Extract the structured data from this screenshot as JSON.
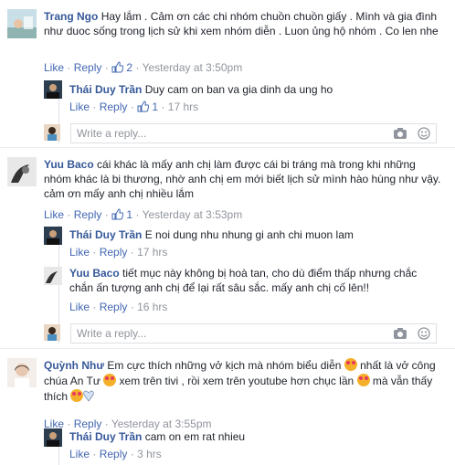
{
  "comments": [
    {
      "author": "Trang Ngo",
      "text": "Hay lắm . Cảm ơn các chi nhóm chuồn chuồn giấy . Mình và gia đình như duoc sống trong lịch sử khi xem nhóm diễn . Luon ủng hộ nhóm . Co len nhe",
      "like_label": "Like",
      "reply_label": "Reply",
      "likes": "2",
      "time": "Yesterday at 3:50pm",
      "replies": [
        {
          "author": "Thái Duy Trần",
          "text": "Duy cam on ban va gia dinh da ung ho",
          "like_label": "Like",
          "reply_label": "Reply",
          "likes": "1",
          "time": "17 hrs"
        }
      ]
    },
    {
      "author": "Yuu Baco",
      "text": "cái khác là mấy anh chị làm được cái bi tráng mà trong khi những nhóm khác là bi thương, nhờ anh chị em mới biết lịch sử mình hào hùng như vậy. cảm ơn mấy anh chị nhiều lắm",
      "like_label": "Like",
      "reply_label": "Reply",
      "likes": "1",
      "time": "Yesterday at 3:53pm",
      "replies": [
        {
          "author": "Thái Duy Trần",
          "text": "E noi dung nhu nhung gi anh chi muon lam",
          "like_label": "Like",
          "reply_label": "Reply",
          "time": "17 hrs"
        },
        {
          "author": "Yuu Baco",
          "text": "tiết mục này không bị hoà tan, cho dù điểm thấp nhưng chắc chắn ấn tượng anh chị để lại rất sâu sắc. mấy anh chị cố lên!!",
          "like_label": "Like",
          "reply_label": "Reply",
          "time": "16 hrs"
        }
      ]
    },
    {
      "author": "Quỳnh Như",
      "text_parts": [
        "Em cực thích những vở kịch mà nhóm biểu diễn ",
        " nhất là vở công chúa An Tư ",
        " xem trên tivi , rồi xem trên youtube hơn chục lần ",
        " mà vẫn thấy thích "
      ],
      "like_label": "Like",
      "reply_label": "Reply",
      "time": "Yesterday at 3:55pm",
      "replies": [
        {
          "author": "Thái Duy Trần",
          "text": "cam on em rat nhieu",
          "like_label": "Like",
          "reply_label": "Reply",
          "time": "3 hrs"
        }
      ]
    }
  ],
  "reply_placeholder": "Write a reply...",
  "icons": [
    "thumbs-up-icon",
    "camera-icon",
    "emoji-icon",
    "love-eyes-emoji-icon",
    "heart-icon"
  ],
  "colors": {
    "link": "#4267b2",
    "author": "#365899",
    "meta": "#90949c"
  }
}
